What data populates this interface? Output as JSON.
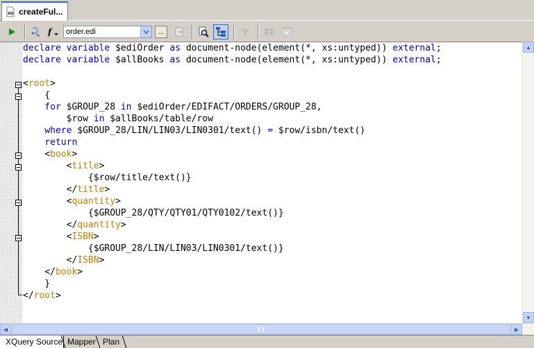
{
  "document_tab": {
    "title": "createFul...",
    "icon": "xquery-file-icon"
  },
  "toolbar": {
    "run_icon": "play-icon",
    "source_select": {
      "value": "order.edi"
    },
    "browse_label": "..."
  },
  "colors": {
    "keyword": "#0000c0",
    "tag": "#c08000",
    "text": "#000000",
    "selection_accent": "#316ac5"
  },
  "code": {
    "lines": [
      [
        [
          "kw",
          "declare variable "
        ],
        [
          "txt",
          "$ediOrder "
        ],
        [
          "kw",
          "as "
        ],
        [
          "txt",
          "document-node(element(*, xs:untyped)) "
        ],
        [
          "kw",
          "external"
        ],
        [
          "txt",
          ";"
        ]
      ],
      [
        [
          "kw",
          "declare variable "
        ],
        [
          "txt",
          "$allBooks "
        ],
        [
          "kw",
          "as "
        ],
        [
          "txt",
          "document-node(element(*, xs:untyped)) "
        ],
        [
          "kw",
          "external"
        ],
        [
          "txt",
          ";"
        ]
      ],
      [],
      [
        [
          "txt",
          "<"
        ],
        [
          "tag",
          "root"
        ],
        [
          "txt",
          ">"
        ]
      ],
      [
        [
          "txt",
          "    {"
        ]
      ],
      [
        [
          "kw",
          "    for "
        ],
        [
          "txt",
          "$GROUP_28 "
        ],
        [
          "kw",
          "in "
        ],
        [
          "txt",
          "$ediOrder/EDIFACT/ORDERS/GROUP_28,"
        ]
      ],
      [
        [
          "txt",
          "        $row "
        ],
        [
          "kw",
          "in "
        ],
        [
          "txt",
          "$allBooks/table/row"
        ]
      ],
      [
        [
          "kw",
          "    where "
        ],
        [
          "txt",
          "$GROUP_28/LIN/LIN03/LIN0301/text() "
        ],
        [
          "kw",
          "= "
        ],
        [
          "txt",
          "$row/isbn/text()"
        ]
      ],
      [
        [
          "kw",
          "    return"
        ]
      ],
      [
        [
          "txt",
          "    <"
        ],
        [
          "tag",
          "book"
        ],
        [
          "txt",
          ">"
        ]
      ],
      [
        [
          "txt",
          "        <"
        ],
        [
          "tag",
          "title"
        ],
        [
          "txt",
          ">"
        ]
      ],
      [
        [
          "txt",
          "            {$row/title/text()}"
        ]
      ],
      [
        [
          "txt",
          "        </"
        ],
        [
          "tag",
          "title"
        ],
        [
          "txt",
          ">"
        ]
      ],
      [
        [
          "txt",
          "        <"
        ],
        [
          "tag",
          "quantity"
        ],
        [
          "txt",
          ">"
        ]
      ],
      [
        [
          "txt",
          "            {$GROUP_28/QTY/QTY01/QTY0102/text()}"
        ]
      ],
      [
        [
          "txt",
          "        </"
        ],
        [
          "tag",
          "quantity"
        ],
        [
          "txt",
          ">"
        ]
      ],
      [
        [
          "txt",
          "        <"
        ],
        [
          "tag",
          "ISBN"
        ],
        [
          "txt",
          ">"
        ]
      ],
      [
        [
          "txt",
          "            {$GROUP_28/LIN/LIN03/LIN0301/text()}"
        ]
      ],
      [
        [
          "txt",
          "        </"
        ],
        [
          "tag",
          "ISBN"
        ],
        [
          "txt",
          ">"
        ]
      ],
      [
        [
          "txt",
          "    </"
        ],
        [
          "tag",
          "book"
        ],
        [
          "txt",
          ">"
        ]
      ],
      [
        [
          "txt",
          "    }"
        ]
      ],
      [
        [
          "txt",
          "</"
        ],
        [
          "tag",
          "root"
        ],
        [
          "txt",
          ">"
        ]
      ]
    ]
  },
  "view_tabs": [
    {
      "label": "XQuery Source",
      "active": true
    },
    {
      "label": "Mapper",
      "active": false
    },
    {
      "label": "Plan",
      "active": false
    }
  ]
}
